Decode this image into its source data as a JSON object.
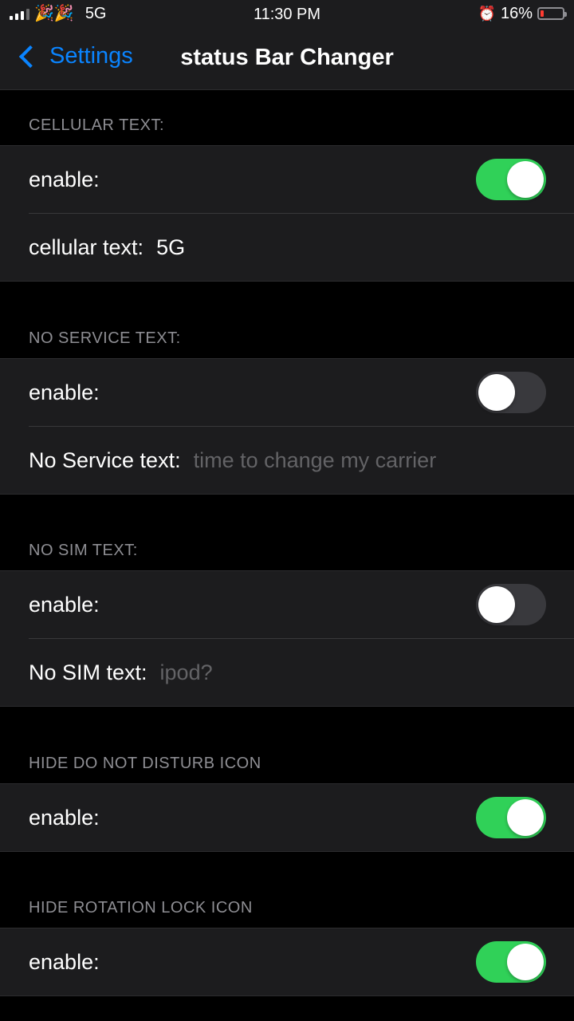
{
  "status_bar": {
    "emoji": "🎉🎉",
    "network": "5G",
    "time": "11:30 PM",
    "alarm_icon": "alarm-clock-icon",
    "battery_percent": "16%",
    "battery_level": 0.16,
    "battery_color": "#ff3b30"
  },
  "nav": {
    "back_label": "Settings",
    "title": "status Bar Changer"
  },
  "sections": [
    {
      "header": "CELLULAR TEXT:",
      "enable_label": "enable:",
      "enabled": true,
      "text_label": "cellular text:",
      "text_value": "5G",
      "text_placeholder": ""
    },
    {
      "header": "NO SERVICE TEXT:",
      "enable_label": "enable:",
      "enabled": false,
      "text_label": "No Service text:",
      "text_value": "",
      "text_placeholder": "time to change my carrier"
    },
    {
      "header": "NO SIM TEXT:",
      "enable_label": "enable:",
      "enabled": false,
      "text_label": "No SIM text:",
      "text_value": "",
      "text_placeholder": "ipod?"
    },
    {
      "header": "HIDE DO NOT DISTURB ICON",
      "enable_label": "enable:",
      "enabled": true
    },
    {
      "header": "HIDE ROTATION LOCK ICON",
      "enable_label": "enable:",
      "enabled": true
    }
  ],
  "colors": {
    "accent": "#0a84ff",
    "toggle_on": "#30d158",
    "toggle_off": "#39393d",
    "cell_background": "#1c1c1e"
  }
}
